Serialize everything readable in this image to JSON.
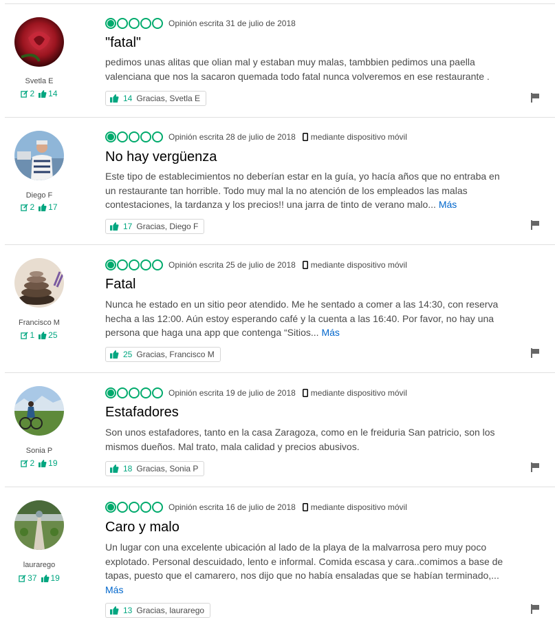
{
  "reviews": [
    {
      "username": "Svetla E",
      "review_count": "2",
      "helpful_count": "14",
      "rating": 1,
      "date": "Opinión escrita 31 de julio de 2018",
      "mobile": "",
      "title": "\"fatal\"",
      "body": "pedimos unas alitas que olian mal y estaban muy malas, tambbien pedimos una paella valenciana que nos la sacaron quemada todo fatal nunca volveremos en ese restaurante .",
      "more": "",
      "thanks_count": "14",
      "thanks_label": "Gracias, Svetla E"
    },
    {
      "username": "Diego F",
      "review_count": "2",
      "helpful_count": "17",
      "rating": 1,
      "date": "Opinión escrita 28 de julio de 2018",
      "mobile": "mediante dispositivo móvil",
      "title": "No hay vergüenza",
      "body": "Este tipo de establecimientos no deberían estar en la guía, yo hacía años que no entraba en un restaurante tan horrible. Todo muy mal la no atención de los empleados las malas contestaciones, la tardanza y los precios!! una jarra de tinto de verano malo...",
      "more": "Más",
      "thanks_count": "17",
      "thanks_label": "Gracias, Diego F"
    },
    {
      "username": "Francisco M",
      "review_count": "1",
      "helpful_count": "25",
      "rating": 1,
      "date": "Opinión escrita 25 de julio de 2018",
      "mobile": "mediante dispositivo móvil",
      "title": "Fatal",
      "body": "Nunca he estado en un sitio peor atendido. Me he sentado a comer a las 14:30, con reserva hecha a las 12:00. Aún estoy esperando café y la cuenta a las 16:40. Por favor, no hay una persona que haga una app que contenga “Sitios...",
      "more": "Más",
      "thanks_count": "25",
      "thanks_label": "Gracias, Francisco M"
    },
    {
      "username": "Sonia P",
      "review_count": "2",
      "helpful_count": "19",
      "rating": 1,
      "date": "Opinión escrita 19 de julio de 2018",
      "mobile": "mediante dispositivo móvil",
      "title": "Estafadores",
      "body": "Son unos estafadores, tanto en la casa Zaragoza, como en le freiduria San patricio, son los mismos dueños. Mal trato, mala calidad y precios abusivos.",
      "more": "",
      "thanks_count": "18",
      "thanks_label": "Gracias, Sonia P"
    },
    {
      "username": "laurarego",
      "review_count": "37",
      "helpful_count": "19",
      "rating": 1,
      "date": "Opinión escrita 16 de julio de 2018",
      "mobile": "mediante dispositivo móvil",
      "title": "Caro y malo",
      "body": "Un lugar con una excelente ubicación al lado de la playa de la malvarrosa pero muy poco explotado. Personal descuidado, lento e informal. Comida escasa y cara..comimos a base de tapas, puesto que el camarero, nos dijo que no había ensaladas que se habían terminado,...",
      "more": "Más",
      "thanks_count": "13",
      "thanks_label": "Gracias, laurarego"
    }
  ],
  "colors": {
    "accent": "#00aa6c",
    "link": "#0066cc",
    "text": "#4a4a4a"
  }
}
